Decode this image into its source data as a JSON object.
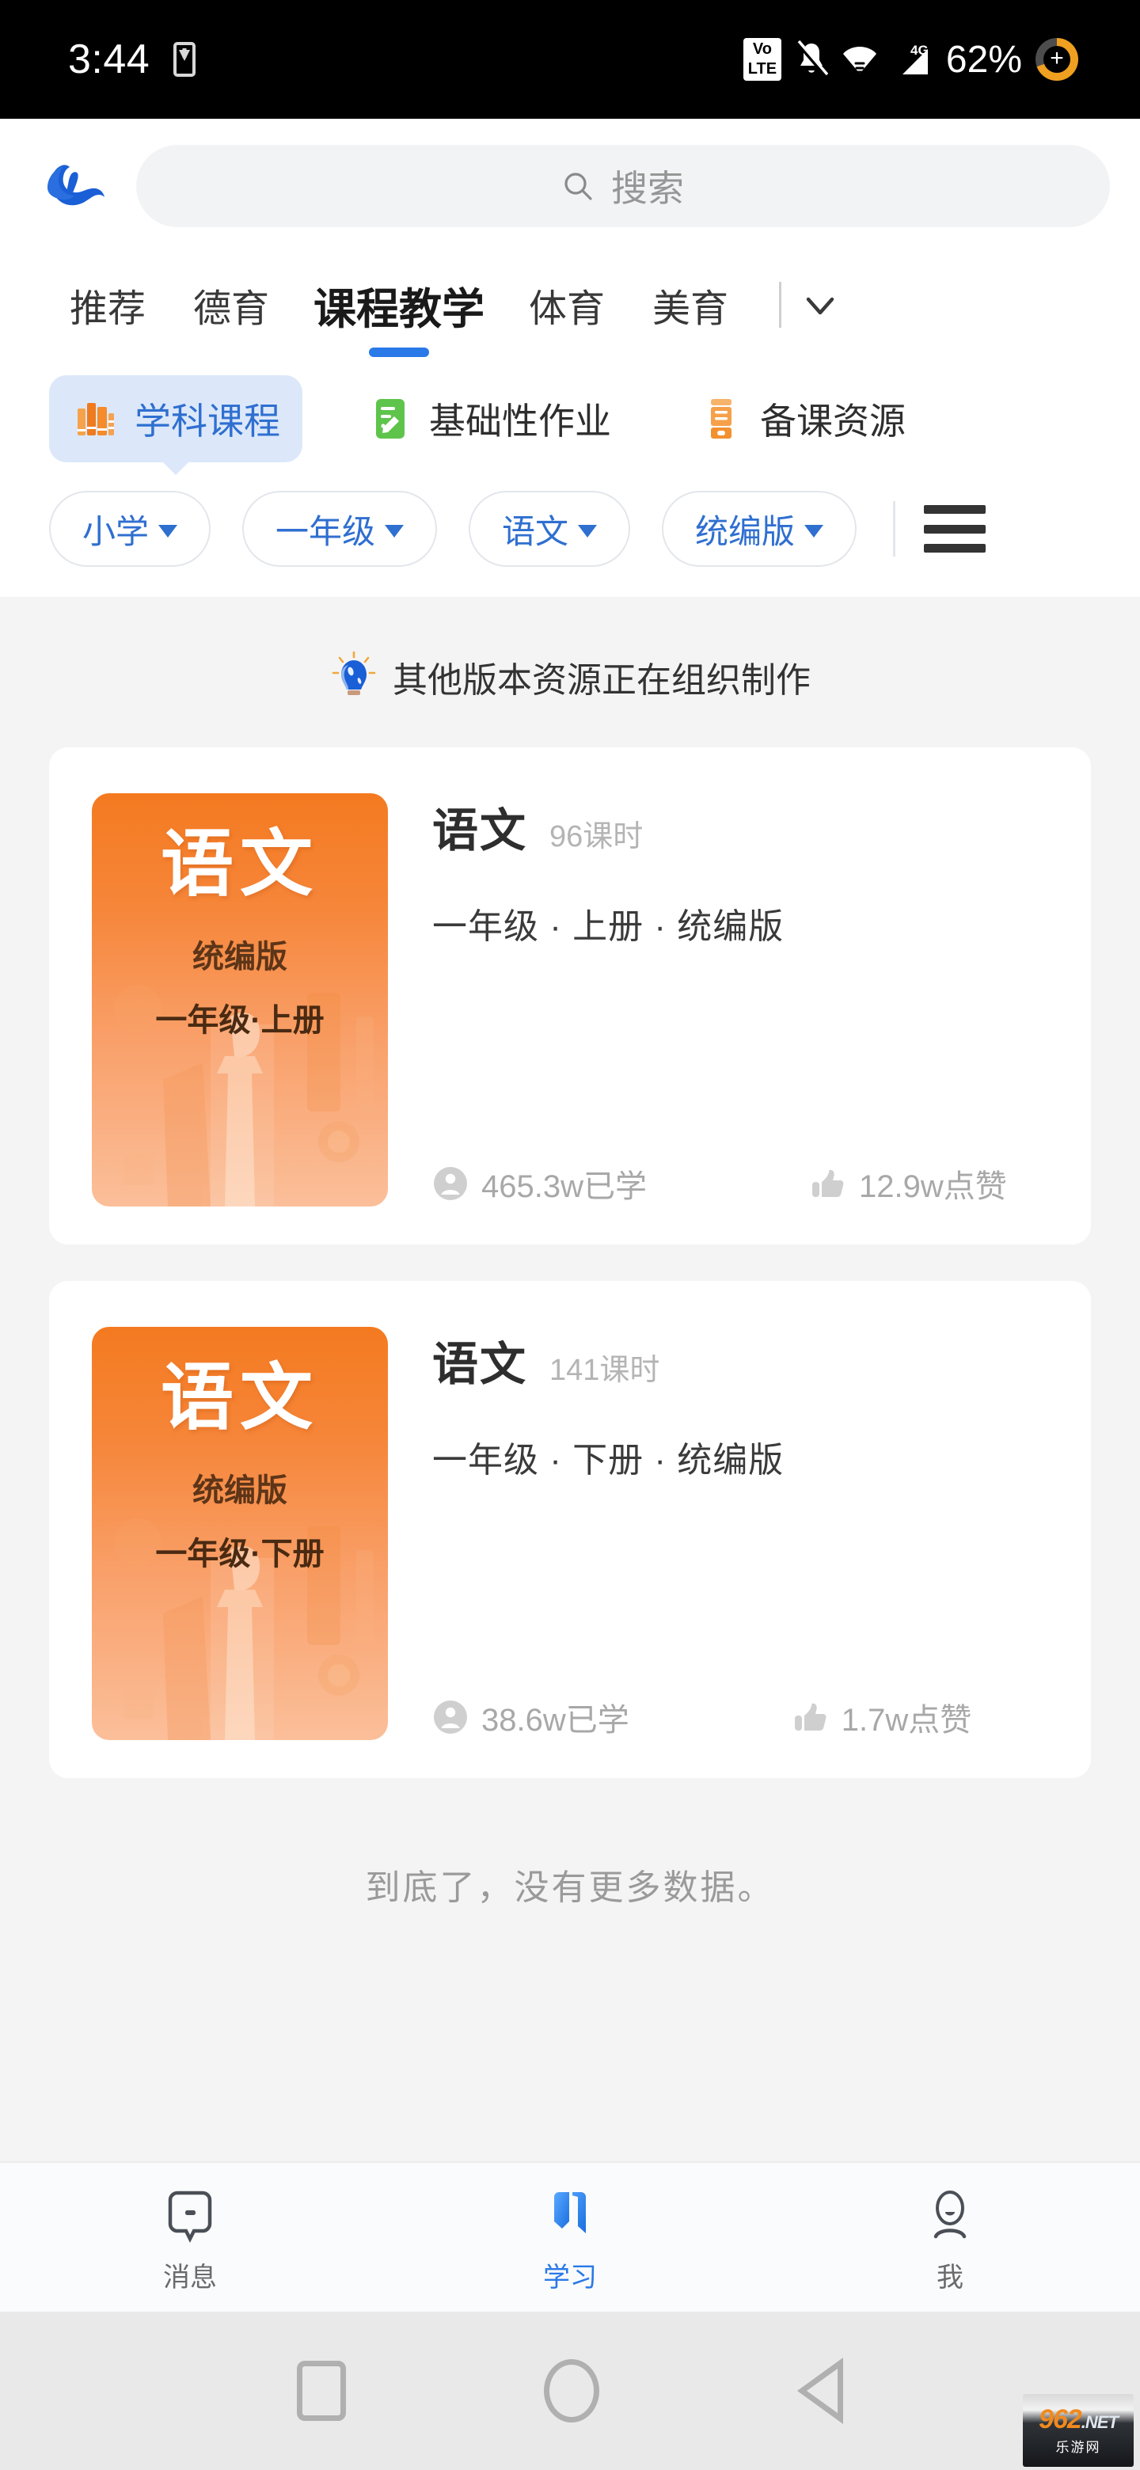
{
  "status_bar": {
    "time": "3:44",
    "download_icon": "download-indicator-icon",
    "volte_top": "Vo",
    "volte_bottom": "LTE",
    "bell_icon": "bell-muted-icon",
    "wifi_icon": "wifi-icon",
    "signal_icon": "signal-4g-icon",
    "signal_label": "4G",
    "battery_percent": "62%",
    "battery_icon": "battery-charging-icon"
  },
  "header": {
    "logo_icon": "app-logo-cloud-icon",
    "search": {
      "icon": "search-icon",
      "placeholder": "搜索",
      "value": ""
    },
    "tabs": [
      {
        "label": "推荐",
        "active": false
      },
      {
        "label": "德育",
        "active": false
      },
      {
        "label": "课程教学",
        "active": true
      },
      {
        "label": "体育",
        "active": false
      },
      {
        "label": "美育",
        "active": false
      }
    ],
    "tabs_expand_icon": "chevron-down-icon",
    "categories": [
      {
        "label": "学科课程",
        "icon": "books-icon",
        "active": true
      },
      {
        "label": "基础性作业",
        "icon": "notebook-pencil-icon",
        "active": false
      },
      {
        "label": "备课资源",
        "icon": "resource-box-icon",
        "active": false
      }
    ],
    "filters": [
      {
        "label": "小学",
        "caret": "caret-down-icon"
      },
      {
        "label": "一年级",
        "caret": "caret-down-icon"
      },
      {
        "label": "语文",
        "caret": "caret-down-icon"
      },
      {
        "label": "统编版",
        "caret": "caret-down-icon"
      }
    ],
    "menu_icon": "hamburger-menu-icon"
  },
  "content": {
    "notice": {
      "icon": "lightbulb-icon",
      "text": "其他版本资源正在组织制作"
    },
    "cards": [
      {
        "cover": {
          "title": "语文",
          "version": "统编版",
          "grade": "一年级·上册",
          "bg_color": "#f4831f"
        },
        "title": "语文",
        "hours": "96课时",
        "subtitle": "一年级 · 上册 · 统编版",
        "learned_icon": "person-icon",
        "learned": "465.3w已学",
        "likes_icon": "thumbs-up-icon",
        "likes": "12.9w点赞"
      },
      {
        "cover": {
          "title": "语文",
          "version": "统编版",
          "grade": "一年级·下册",
          "bg_color": "#f4831f"
        },
        "title": "语文",
        "hours": "141课时",
        "subtitle": "一年级 · 下册 · 统编版",
        "learned_icon": "person-icon",
        "learned": "38.6w已学",
        "likes_icon": "thumbs-up-icon",
        "likes": "1.7w点赞"
      }
    ],
    "end_text": "到底了，没有更多数据。"
  },
  "bottom_nav": [
    {
      "label": "消息",
      "icon": "message-bubble-icon",
      "active": false
    },
    {
      "label": "学习",
      "icon": "book-bookmark-icon",
      "active": true
    },
    {
      "label": "我",
      "icon": "person-outline-icon",
      "active": false
    }
  ],
  "android_nav": {
    "recents_icon": "square-recents-icon",
    "home_icon": "circle-home-icon",
    "back_icon": "triangle-back-icon"
  },
  "watermark": {
    "brand": "962",
    "tld": ".NET",
    "sub": "乐游网"
  },
  "colors": {
    "accent_blue": "#2979e8",
    "chip_blue_bg": "#dce8fa",
    "pill_text": "#2f6fd0",
    "cover_orange": "#f4831f",
    "muted_gray": "#a8a8a8"
  }
}
